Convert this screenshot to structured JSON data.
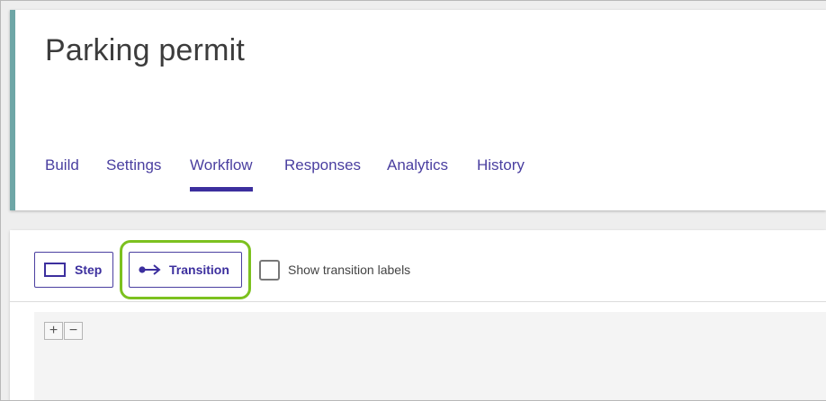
{
  "page": {
    "title": "Parking permit"
  },
  "tabs": [
    {
      "label": "Build"
    },
    {
      "label": "Settings"
    },
    {
      "label": "Workflow",
      "active": true
    },
    {
      "label": "Responses"
    },
    {
      "label": "Analytics"
    },
    {
      "label": "History"
    }
  ],
  "toolbar": {
    "step_label": "Step",
    "transition_label": "Transition",
    "show_labels_text": "Show transition labels",
    "show_labels_checked": false
  },
  "canvas": {
    "zoom_in": "+",
    "zoom_out": "−"
  },
  "colors": {
    "accent": "#3c2f9e",
    "header_border": "#6ea6a6",
    "highlight": "#7cc11f"
  },
  "icons": {
    "step": "rectangle-icon",
    "transition": "arrow-right-icon"
  }
}
